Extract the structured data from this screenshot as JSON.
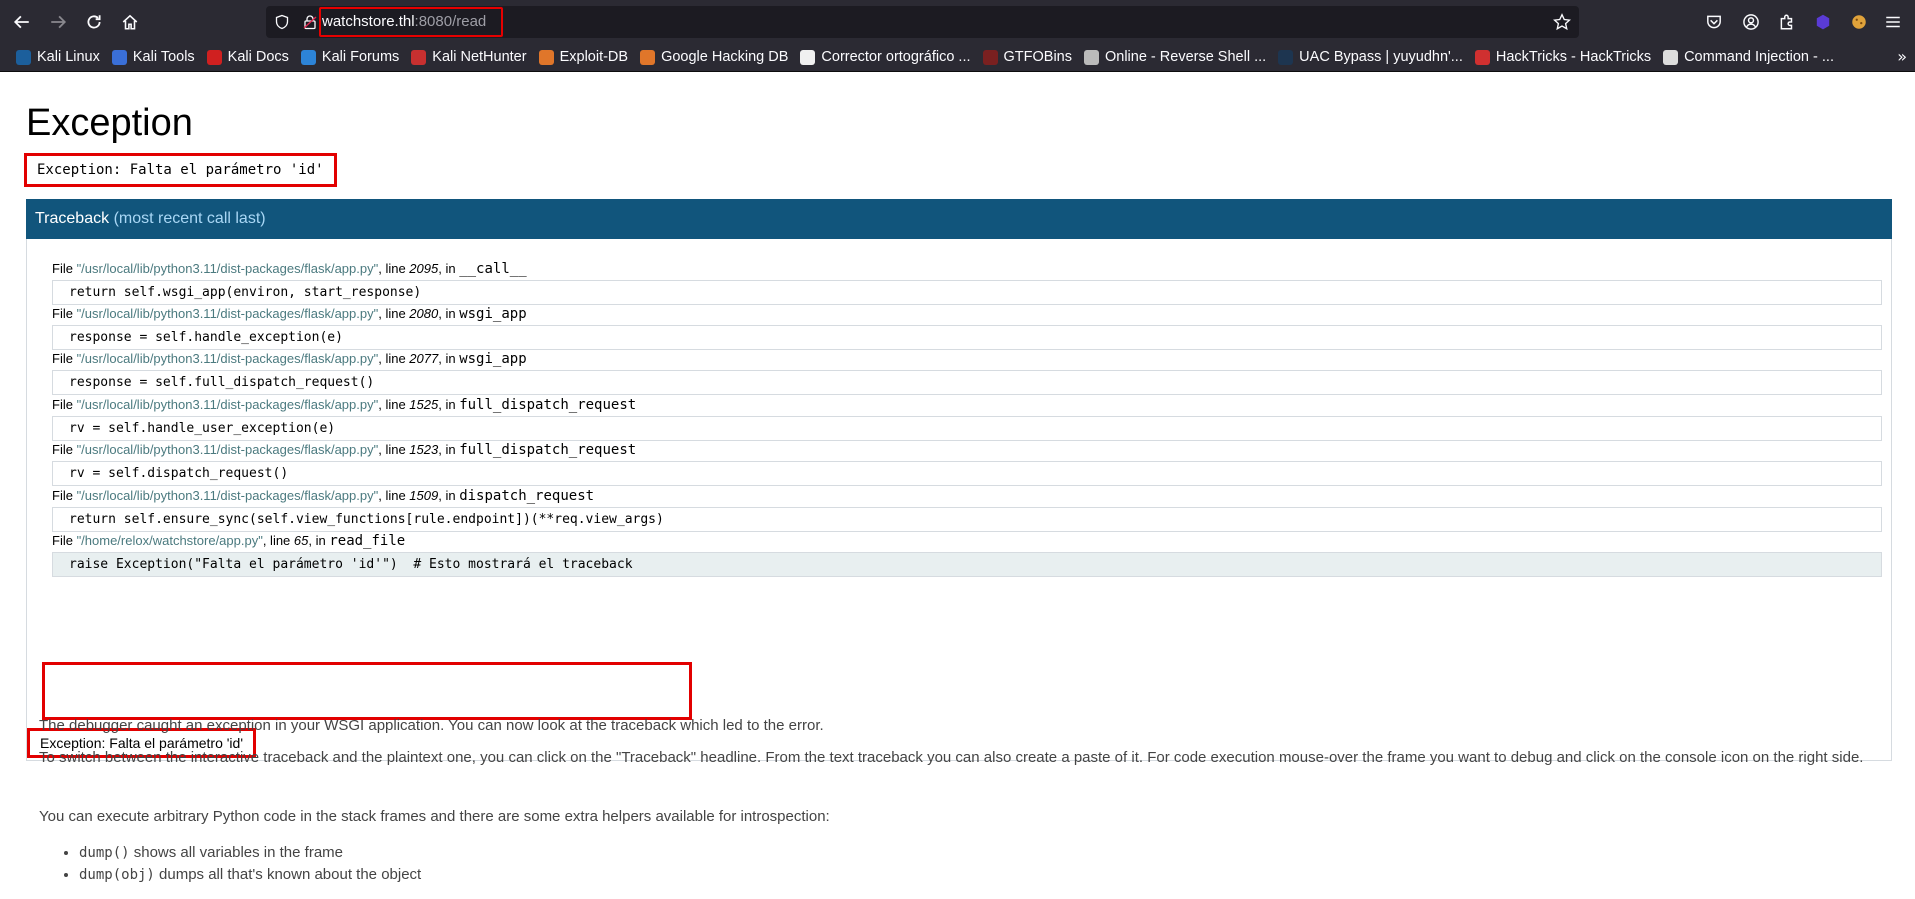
{
  "browser": {
    "url_host": "watchstore.thl",
    "url_rest": ":8080/read",
    "bookmarks": [
      {
        "label": "Kali Linux",
        "color": "#1c5f9c"
      },
      {
        "label": "Kali Tools",
        "color": "#3a6fd8"
      },
      {
        "label": "Kali Docs",
        "color": "#d02020"
      },
      {
        "label": "Kali Forums",
        "color": "#2d84d8"
      },
      {
        "label": "Kali NetHunter",
        "color": "#c83030"
      },
      {
        "label": "Exploit-DB",
        "color": "#e0762a"
      },
      {
        "label": "Google Hacking DB",
        "color": "#e0762a"
      },
      {
        "label": "Corrector ortográfico ...",
        "color": "#f0f0f0"
      },
      {
        "label": "GTFOBins",
        "color": "#7a2020"
      },
      {
        "label": "Online - Reverse Shell ...",
        "color": "#bbbbbb"
      },
      {
        "label": "UAC Bypass | yuyudhn'...",
        "color": "#1d3550"
      },
      {
        "label": "HackTricks - HackTricks",
        "color": "#d03030"
      },
      {
        "label": "Command Injection - ...",
        "color": "#dddddd"
      }
    ]
  },
  "page": {
    "title": "Exception",
    "error_message": "Exception: Falta el parámetro 'id'",
    "traceback_label": "Traceback",
    "traceback_sub": "(most recent call last)",
    "frames": [
      {
        "file_prefix": "File ",
        "file": "\"/usr/local/lib/python3.11/dist-packages/flask/app.py\"",
        "line_prefix": ", line ",
        "line": "2095",
        "in_prefix": ", in ",
        "func": "__call__",
        "code": "return self.wsgi_app(environ, start_response)"
      },
      {
        "file_prefix": "File ",
        "file": "\"/usr/local/lib/python3.11/dist-packages/flask/app.py\"",
        "line_prefix": ", line ",
        "line": "2080",
        "in_prefix": ", in ",
        "func": "wsgi_app",
        "code": "response = self.handle_exception(e)"
      },
      {
        "file_prefix": "File ",
        "file": "\"/usr/local/lib/python3.11/dist-packages/flask/app.py\"",
        "line_prefix": ", line ",
        "line": "2077",
        "in_prefix": ", in ",
        "func": "wsgi_app",
        "code": "response = self.full_dispatch_request()"
      },
      {
        "file_prefix": "File ",
        "file": "\"/usr/local/lib/python3.11/dist-packages/flask/app.py\"",
        "line_prefix": ", line ",
        "line": "1525",
        "in_prefix": ", in ",
        "func": "full_dispatch_request",
        "code": "rv = self.handle_user_exception(e)"
      },
      {
        "file_prefix": "File ",
        "file": "\"/usr/local/lib/python3.11/dist-packages/flask/app.py\"",
        "line_prefix": ", line ",
        "line": "1523",
        "in_prefix": ", in ",
        "func": "full_dispatch_request",
        "code": "rv = self.dispatch_request()"
      },
      {
        "file_prefix": "File ",
        "file": "\"/usr/local/lib/python3.11/dist-packages/flask/app.py\"",
        "line_prefix": ", line ",
        "line": "1509",
        "in_prefix": ", in ",
        "func": "dispatch_request",
        "code": "return self.ensure_sync(self.view_functions[rule.endpoint])(**req.view_args)"
      },
      {
        "file_prefix": "File ",
        "file": "\"/home/relox/watchstore/app.py\"",
        "line_prefix": ", line ",
        "line": "65",
        "in_prefix": ", in ",
        "func": "read_file",
        "code": "raise Exception(\"Falta el parámetro 'id'\")  # Esto mostrará el traceback"
      }
    ],
    "bottom_error": "Exception: Falta el parámetro 'id'",
    "explain_1": "The debugger caught an exception in your WSGI application. You can now look at the traceback which led to the error.",
    "explain_2": "To switch between the interactive traceback and the plaintext one, you can click on the \"Traceback\" headline. From the text traceback you can also create a paste of it. For code execution mouse-over the frame you want to debug and click on the console icon on the right side.",
    "explain_3": "You can execute arbitrary Python code in the stack frames and there are some extra helpers available for introspection:",
    "helpers": [
      {
        "code": "dump()",
        "text": " shows all variables in the frame"
      },
      {
        "code": "dump(obj)",
        "text": " dumps all that's known about the object"
      }
    ]
  }
}
